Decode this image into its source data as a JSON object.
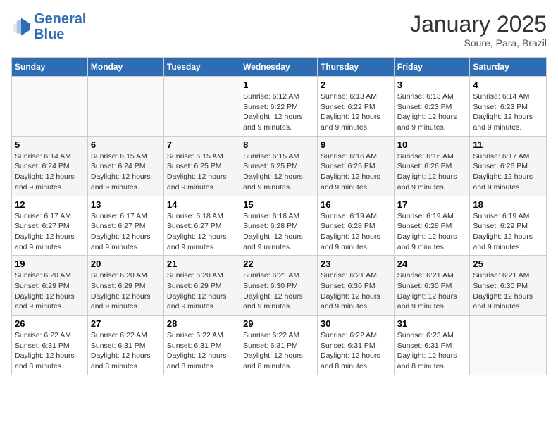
{
  "header": {
    "logo_general": "General",
    "logo_blue": "Blue",
    "month": "January 2025",
    "location": "Soure, Para, Brazil"
  },
  "days_of_week": [
    "Sunday",
    "Monday",
    "Tuesday",
    "Wednesday",
    "Thursday",
    "Friday",
    "Saturday"
  ],
  "weeks": [
    [
      {
        "day": "",
        "info": ""
      },
      {
        "day": "",
        "info": ""
      },
      {
        "day": "",
        "info": ""
      },
      {
        "day": "1",
        "info": "Sunrise: 6:12 AM\nSunset: 6:22 PM\nDaylight: 12 hours and 9 minutes."
      },
      {
        "day": "2",
        "info": "Sunrise: 6:13 AM\nSunset: 6:22 PM\nDaylight: 12 hours and 9 minutes."
      },
      {
        "day": "3",
        "info": "Sunrise: 6:13 AM\nSunset: 6:23 PM\nDaylight: 12 hours and 9 minutes."
      },
      {
        "day": "4",
        "info": "Sunrise: 6:14 AM\nSunset: 6:23 PM\nDaylight: 12 hours and 9 minutes."
      }
    ],
    [
      {
        "day": "5",
        "info": "Sunrise: 6:14 AM\nSunset: 6:24 PM\nDaylight: 12 hours and 9 minutes."
      },
      {
        "day": "6",
        "info": "Sunrise: 6:15 AM\nSunset: 6:24 PM\nDaylight: 12 hours and 9 minutes."
      },
      {
        "day": "7",
        "info": "Sunrise: 6:15 AM\nSunset: 6:25 PM\nDaylight: 12 hours and 9 minutes."
      },
      {
        "day": "8",
        "info": "Sunrise: 6:15 AM\nSunset: 6:25 PM\nDaylight: 12 hours and 9 minutes."
      },
      {
        "day": "9",
        "info": "Sunrise: 6:16 AM\nSunset: 6:25 PM\nDaylight: 12 hours and 9 minutes."
      },
      {
        "day": "10",
        "info": "Sunrise: 6:16 AM\nSunset: 6:26 PM\nDaylight: 12 hours and 9 minutes."
      },
      {
        "day": "11",
        "info": "Sunrise: 6:17 AM\nSunset: 6:26 PM\nDaylight: 12 hours and 9 minutes."
      }
    ],
    [
      {
        "day": "12",
        "info": "Sunrise: 6:17 AM\nSunset: 6:27 PM\nDaylight: 12 hours and 9 minutes."
      },
      {
        "day": "13",
        "info": "Sunrise: 6:17 AM\nSunset: 6:27 PM\nDaylight: 12 hours and 9 minutes."
      },
      {
        "day": "14",
        "info": "Sunrise: 6:18 AM\nSunset: 6:27 PM\nDaylight: 12 hours and 9 minutes."
      },
      {
        "day": "15",
        "info": "Sunrise: 6:18 AM\nSunset: 6:28 PM\nDaylight: 12 hours and 9 minutes."
      },
      {
        "day": "16",
        "info": "Sunrise: 6:19 AM\nSunset: 6:28 PM\nDaylight: 12 hours and 9 minutes."
      },
      {
        "day": "17",
        "info": "Sunrise: 6:19 AM\nSunset: 6:28 PM\nDaylight: 12 hours and 9 minutes."
      },
      {
        "day": "18",
        "info": "Sunrise: 6:19 AM\nSunset: 6:29 PM\nDaylight: 12 hours and 9 minutes."
      }
    ],
    [
      {
        "day": "19",
        "info": "Sunrise: 6:20 AM\nSunset: 6:29 PM\nDaylight: 12 hours and 9 minutes."
      },
      {
        "day": "20",
        "info": "Sunrise: 6:20 AM\nSunset: 6:29 PM\nDaylight: 12 hours and 9 minutes."
      },
      {
        "day": "21",
        "info": "Sunrise: 6:20 AM\nSunset: 6:29 PM\nDaylight: 12 hours and 9 minutes."
      },
      {
        "day": "22",
        "info": "Sunrise: 6:21 AM\nSunset: 6:30 PM\nDaylight: 12 hours and 9 minutes."
      },
      {
        "day": "23",
        "info": "Sunrise: 6:21 AM\nSunset: 6:30 PM\nDaylight: 12 hours and 9 minutes."
      },
      {
        "day": "24",
        "info": "Sunrise: 6:21 AM\nSunset: 6:30 PM\nDaylight: 12 hours and 9 minutes."
      },
      {
        "day": "25",
        "info": "Sunrise: 6:21 AM\nSunset: 6:30 PM\nDaylight: 12 hours and 9 minutes."
      }
    ],
    [
      {
        "day": "26",
        "info": "Sunrise: 6:22 AM\nSunset: 6:31 PM\nDaylight: 12 hours and 8 minutes."
      },
      {
        "day": "27",
        "info": "Sunrise: 6:22 AM\nSunset: 6:31 PM\nDaylight: 12 hours and 8 minutes."
      },
      {
        "day": "28",
        "info": "Sunrise: 6:22 AM\nSunset: 6:31 PM\nDaylight: 12 hours and 8 minutes."
      },
      {
        "day": "29",
        "info": "Sunrise: 6:22 AM\nSunset: 6:31 PM\nDaylight: 12 hours and 8 minutes."
      },
      {
        "day": "30",
        "info": "Sunrise: 6:22 AM\nSunset: 6:31 PM\nDaylight: 12 hours and 8 minutes."
      },
      {
        "day": "31",
        "info": "Sunrise: 6:23 AM\nSunset: 6:31 PM\nDaylight: 12 hours and 8 minutes."
      },
      {
        "day": "",
        "info": ""
      }
    ]
  ]
}
